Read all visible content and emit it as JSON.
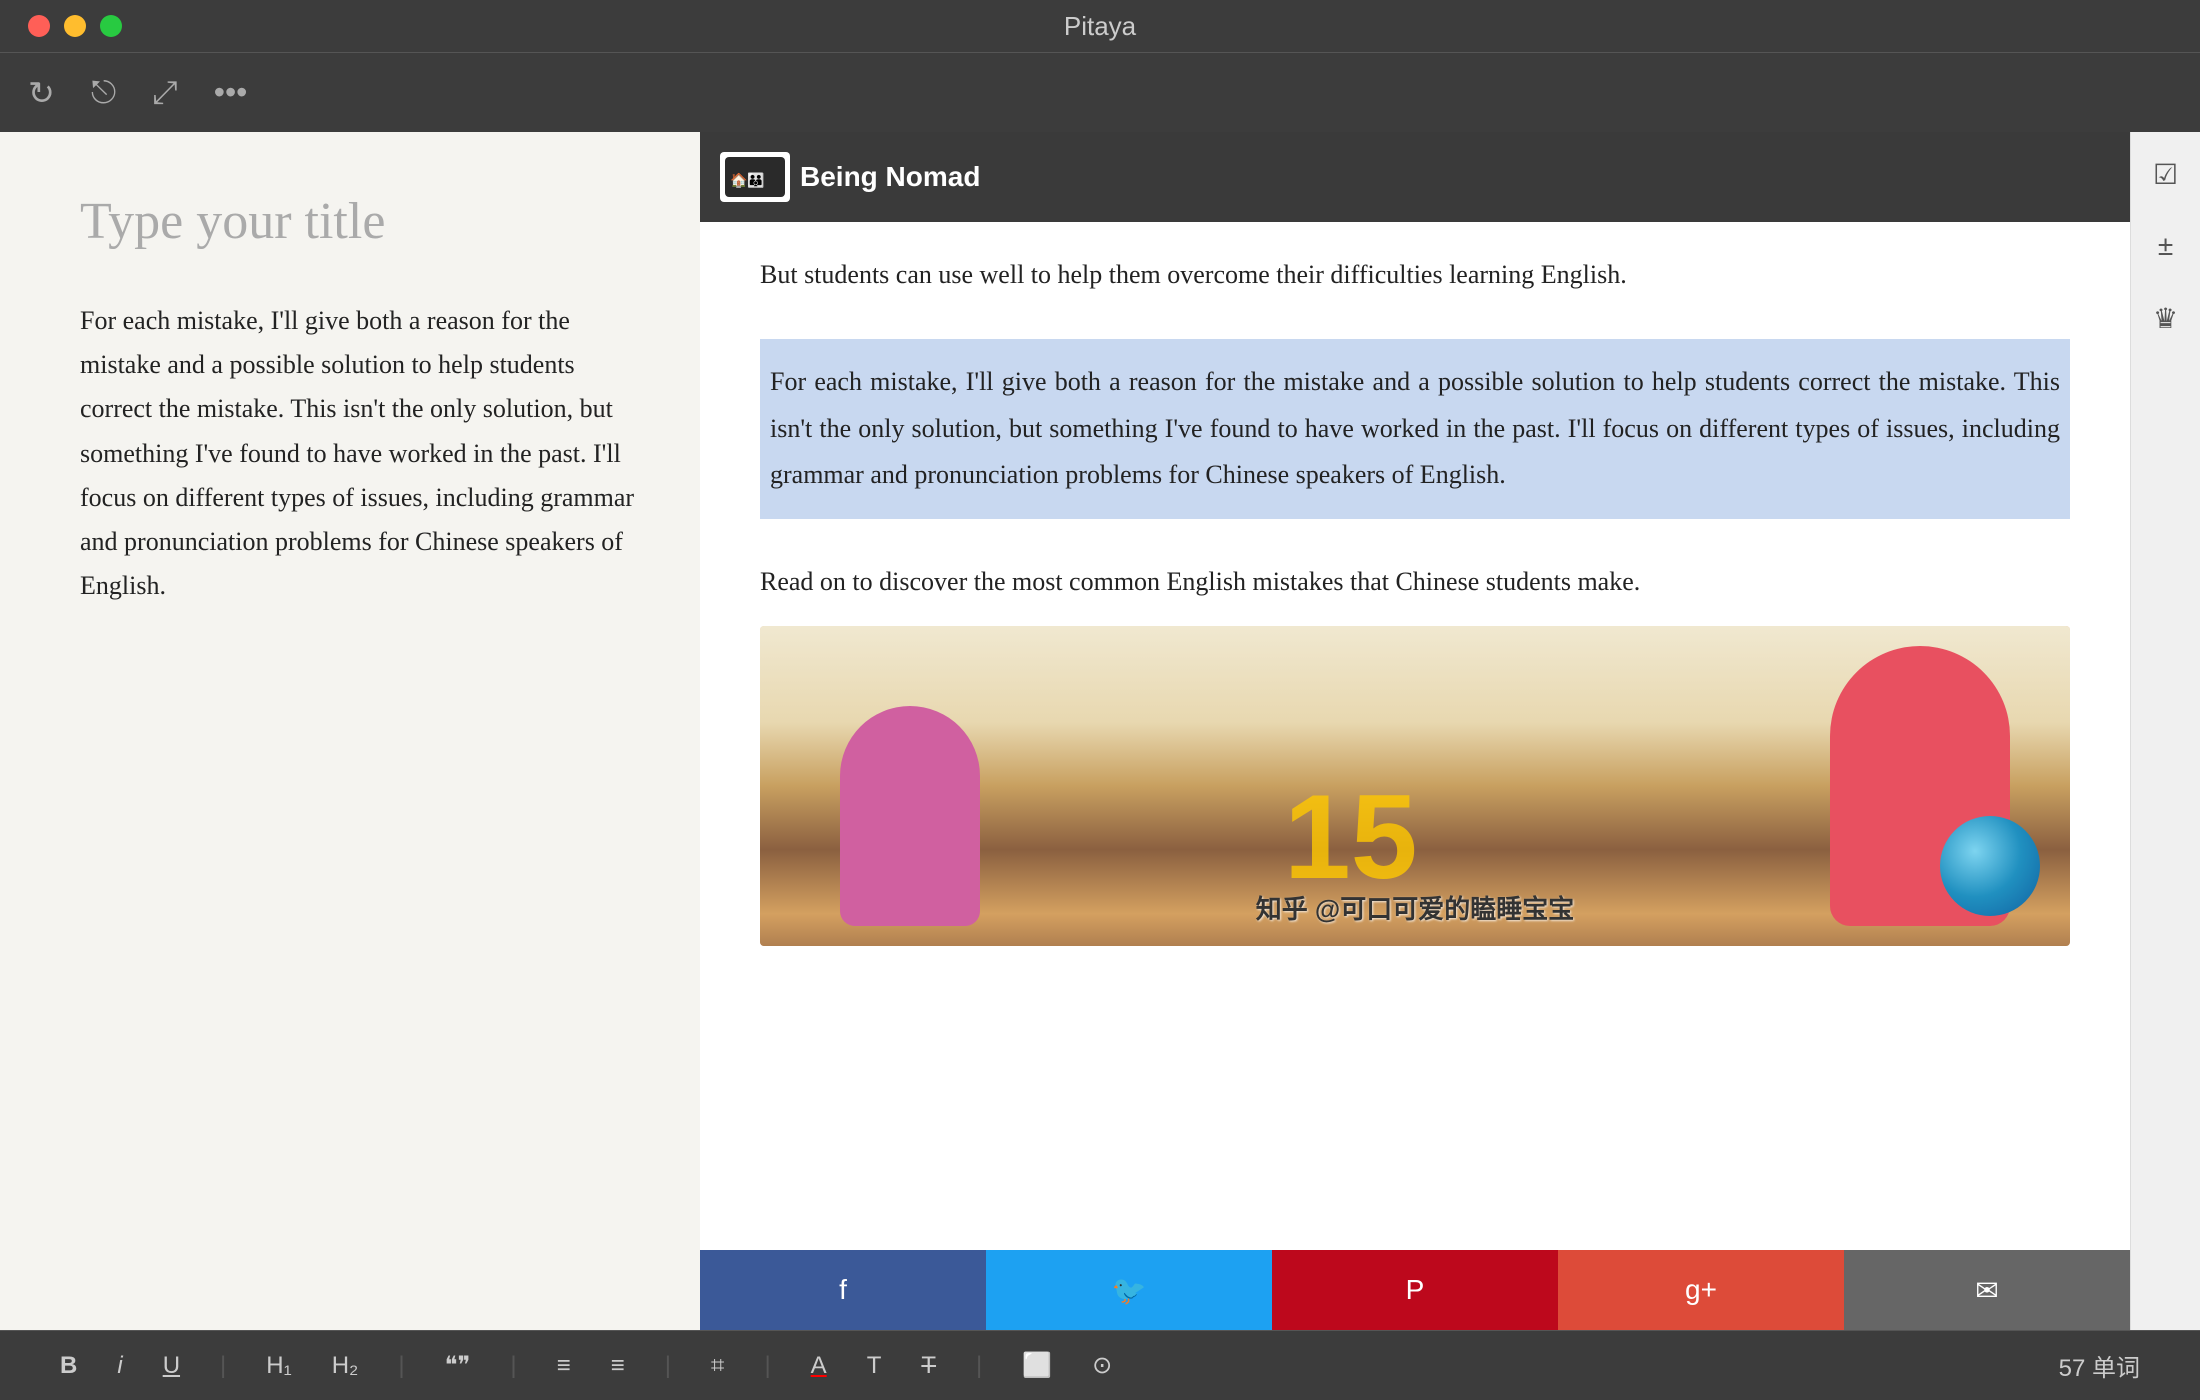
{
  "app": {
    "title": "Pitaya",
    "window_controls": {
      "close": "close",
      "minimize": "minimize",
      "maximize": "maximize"
    }
  },
  "toolbar": {
    "icons": [
      "refresh",
      "share",
      "fullscreen",
      "more"
    ]
  },
  "editor": {
    "title_placeholder": "Type your title",
    "body_text": "For each mistake, I'll give both a reason for the mistake and a possible solution to help students correct the mistake. This isn't the only solution, but something I've found to have worked in the past. I'll focus on different types of issues, including grammar and pronunciation problems for Chinese speakers of English."
  },
  "browser": {
    "logo_text": "Being Nomad",
    "logo_icon_text": "🏠👪",
    "text_top": "But students can use well to help them overcome their difficulties learning English.",
    "highlighted_paragraph": "For each mistake, I'll give both a reason for the mistake and a possible solution to help students correct the mistake. This isn't the only solution, but something I've found to have worked in the past. I'll focus on different types of issues, including grammar and pronunciation problems for Chinese speakers of English.",
    "text_bottom": "Read on to discover the most common English mistakes that Chinese students make.",
    "image_watermark": "知乎 @可口可爱的瞌睡宝宝",
    "number_overlay": "15"
  },
  "social_bar": {
    "buttons": [
      "facebook",
      "twitter",
      "pinterest",
      "google-plus",
      "email"
    ]
  },
  "right_sidebar": {
    "icons": [
      "checkbox",
      "plus-minus",
      "crown"
    ]
  },
  "status_bar": {
    "items": {
      "bold": "B",
      "italic": "i",
      "underline": "U",
      "h1": "H₁",
      "h2": "H₂",
      "quote": "❝❞",
      "list_bullet": "≡",
      "list_number": "≡",
      "link": "⌗",
      "text_color": "A",
      "T": "T",
      "strikethrough": "T̶",
      "image": "⬜",
      "clock": "⊙"
    },
    "word_count": "57 单词"
  }
}
